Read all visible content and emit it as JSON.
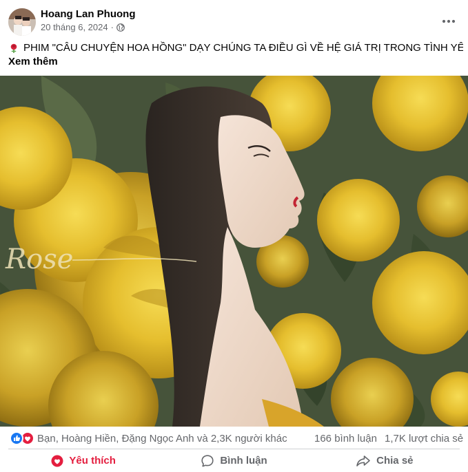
{
  "post": {
    "author": "Hoang Lan Phuong",
    "date": "20 tháng 6, 2024",
    "separator": "·",
    "privacy_icon": "globe-icon",
    "caption": "PHIM \"CÂU CHUYỆN HOA HỒNG\" DẠY CHÚNG TA ĐIỀU GÌ VỀ HỆ GIÁ TRỊ TRONG TÌNH YÊU?...",
    "see_more": "Xem thêm",
    "image_overlay_text": "Rose"
  },
  "reactions": {
    "icons": [
      "like-icon",
      "love-icon"
    ],
    "summary": "Bạn, Hoàng Hiền, Đặng Ngọc Anh và 2,3K người khác",
    "comments": "166 bình luận",
    "shares": "1,7K lượt chia sẻ"
  },
  "actions": {
    "like_label": "Yêu thích",
    "comment_label": "Bình luận",
    "share_label": "Chia sẻ"
  },
  "colors": {
    "love": "#e41e3f",
    "like": "#1877f2",
    "muted": "#65676b",
    "rose_yellow": "#e8c233",
    "leaf": "#3e4a30"
  }
}
